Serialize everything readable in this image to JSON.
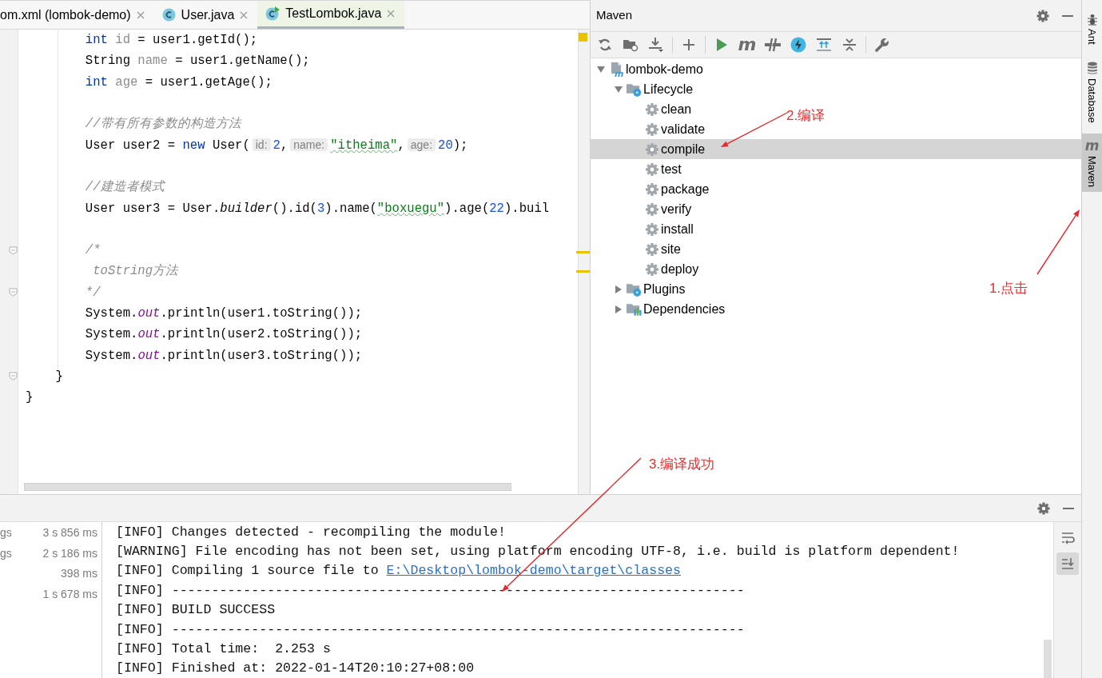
{
  "editor": {
    "tabs": [
      {
        "label": "om.xml (lombok-demo)",
        "kind": "xml",
        "selected": false
      },
      {
        "label": "User.java",
        "kind": "class",
        "selected": false
      },
      {
        "label": "TestLombok.java",
        "kind": "runnable-class",
        "selected": true
      }
    ],
    "lines": [
      {
        "tokens": [
          {
            "kind": "keyword",
            "text": "        int"
          },
          {
            "kind": "unused",
            "text": " id"
          },
          {
            "kind": "plain",
            "text": " = user1.getId();"
          }
        ]
      },
      {
        "tokens": [
          {
            "kind": "plain",
            "text": "        String"
          },
          {
            "kind": "unused",
            "text": " name"
          },
          {
            "kind": "plain",
            "text": " = user1.getName();"
          }
        ]
      },
      {
        "tokens": [
          {
            "kind": "keyword",
            "text": "        int"
          },
          {
            "kind": "unused",
            "text": " age"
          },
          {
            "kind": "plain",
            "text": " = user1.getAge();"
          }
        ]
      },
      {
        "blank_before": true,
        "tokens": [
          {
            "kind": "comment",
            "text": "        //带有所有参数的构造方法"
          }
        ]
      },
      {
        "tokens": [
          {
            "kind": "plain",
            "text": "        User user2 = "
          },
          {
            "kind": "keyword",
            "text": "new"
          },
          {
            "kind": "plain",
            "text": " User("
          },
          {
            "kind": "hint",
            "text": "id:"
          },
          {
            "kind": "number",
            "text": "2"
          },
          {
            "kind": "plain",
            "text": ","
          },
          {
            "kind": "hint",
            "text": "name:"
          },
          {
            "kind": "typo-string",
            "text": "\"itheima\""
          },
          {
            "kind": "plain",
            "text": ","
          },
          {
            "kind": "hint",
            "text": "age:"
          },
          {
            "kind": "number",
            "text": "20"
          },
          {
            "kind": "plain",
            "text": ");"
          }
        ]
      },
      {
        "blank_before": true,
        "tokens": [
          {
            "kind": "comment",
            "text": "        //建造者模式"
          }
        ]
      },
      {
        "tokens": [
          {
            "kind": "plain",
            "text": "        User user3 = User."
          },
          {
            "kind": "method",
            "text": "builder"
          },
          {
            "kind": "plain",
            "text": "().id("
          },
          {
            "kind": "number",
            "text": "3"
          },
          {
            "kind": "plain",
            "text": ").name("
          },
          {
            "kind": "typo-string",
            "text": "\"boxuegu\""
          },
          {
            "kind": "plain",
            "text": ").age("
          },
          {
            "kind": "number",
            "text": "22"
          },
          {
            "kind": "plain",
            "text": ").buil"
          }
        ]
      },
      {
        "blank_before": true,
        "fold": true,
        "tokens": [
          {
            "kind": "comment",
            "text": "        /*"
          }
        ]
      },
      {
        "tokens": [
          {
            "kind": "comment",
            "text": "         toString方法"
          }
        ]
      },
      {
        "fold": true,
        "tokens": [
          {
            "kind": "comment",
            "text": "        */"
          }
        ]
      },
      {
        "tokens": [
          {
            "kind": "plain",
            "text": "        System."
          },
          {
            "kind": "static",
            "text": "out"
          },
          {
            "kind": "plain",
            "text": ".println(user1.toString());"
          }
        ]
      },
      {
        "tokens": [
          {
            "kind": "plain",
            "text": "        System."
          },
          {
            "kind": "static",
            "text": "out"
          },
          {
            "kind": "plain",
            "text": ".println(user2.toString());"
          }
        ]
      },
      {
        "tokens": [
          {
            "kind": "plain",
            "text": "        System."
          },
          {
            "kind": "static",
            "text": "out"
          },
          {
            "kind": "plain",
            "text": ".println(user3.toString());"
          }
        ]
      },
      {
        "fold": true,
        "tokens": [
          {
            "kind": "plain",
            "text": "    }"
          }
        ]
      },
      {
        "tokens": [
          {
            "kind": "plain",
            "text": "}"
          }
        ]
      }
    ]
  },
  "maven": {
    "title": "Maven",
    "toolbar": [
      {
        "kind": "refresh"
      },
      {
        "kind": "folder-refresh"
      },
      {
        "kind": "download"
      },
      {
        "kind": "separator"
      },
      {
        "kind": "plus"
      },
      {
        "kind": "separator"
      },
      {
        "kind": "run"
      },
      {
        "kind": "m",
        "glyph": "m"
      },
      {
        "kind": "skip-tests"
      },
      {
        "kind": "offline"
      },
      {
        "kind": "expand"
      },
      {
        "kind": "collapse"
      },
      {
        "kind": "separator"
      },
      {
        "kind": "wrench"
      }
    ],
    "tree": [
      {
        "label": "lombok-demo",
        "kind": "project",
        "expanded": true,
        "selected": false,
        "children": [
          {
            "label": "Lifecycle",
            "kind": "lifecycle",
            "expanded": true,
            "selected": false,
            "children": [
              {
                "label": "clean",
                "kind": "goal",
                "selected": false
              },
              {
                "label": "validate",
                "kind": "goal",
                "selected": false
              },
              {
                "label": "compile",
                "kind": "goal",
                "selected": true
              },
              {
                "label": "test",
                "kind": "goal",
                "selected": false
              },
              {
                "label": "package",
                "kind": "goal",
                "selected": false
              },
              {
                "label": "verify",
                "kind": "goal",
                "selected": false
              },
              {
                "label": "install",
                "kind": "goal",
                "selected": false
              },
              {
                "label": "site",
                "kind": "goal",
                "selected": false
              },
              {
                "label": "deploy",
                "kind": "goal",
                "selected": false
              }
            ]
          },
          {
            "label": "Plugins",
            "kind": "plugins",
            "expanded": false,
            "selected": false
          },
          {
            "label": "Dependencies",
            "kind": "dependencies",
            "expanded": false,
            "selected": false
          }
        ]
      }
    ]
  },
  "side_tabs": [
    {
      "label": "Ant",
      "kind": "ant",
      "selected": false
    },
    {
      "label": "Database",
      "kind": "database",
      "selected": false
    },
    {
      "label": "Maven",
      "kind": "maven",
      "glyph": "m",
      "selected": true
    }
  ],
  "build": {
    "rows": [
      {
        "label": "gs",
        "time": "3 s 856 ms"
      },
      {
        "label": "gs",
        "time": "2 s 186 ms"
      },
      {
        "time": "398 ms"
      },
      {
        "time": "1 s 678 ms"
      }
    ],
    "console": [
      {
        "text": "[INFO] Changes detected - recompiling the module!"
      },
      {
        "text": "[WARNING] File encoding has not been set, using platform encoding UTF-8, i.e. build is platform dependent!"
      },
      {
        "text": "[INFO] Compiling 1 source file to ",
        "link": "E:\\Desktop\\lombok-demo\\target\\classes"
      },
      {
        "text": "[INFO] ------------------------------------------------------------------------"
      },
      {
        "text": "[INFO] BUILD SUCCESS"
      },
      {
        "text": "[INFO] ------------------------------------------------------------------------"
      },
      {
        "text": "[INFO] Total time:  2.253 s"
      },
      {
        "text": "[INFO] Finished at: 2022-01-14T20:10:27+08:00"
      }
    ],
    "side_buttons": [
      {
        "kind": "soft-wrap",
        "selected": false
      },
      {
        "kind": "scroll-to-end",
        "selected": true
      }
    ]
  },
  "annotations": [
    {
      "label": "1.点击"
    },
    {
      "label": "2.编译"
    },
    {
      "label": "3.编译成功"
    }
  ]
}
